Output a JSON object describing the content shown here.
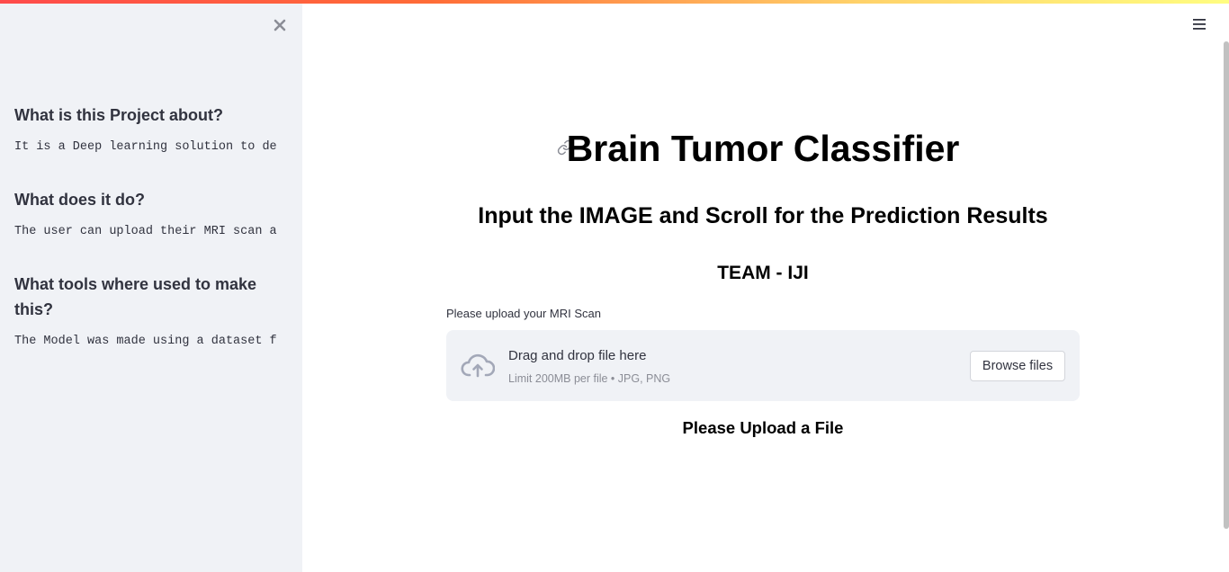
{
  "app": {
    "accent_gradient": [
      "#ff4b4b",
      "#ffd26a",
      "#fffd80"
    ],
    "sidebar_bg": "#f0f2f6"
  },
  "sidebar": {
    "close_icon": "close-icon",
    "sections": [
      {
        "heading": "What is this Project about?",
        "text": "It is a Deep learning solution to de"
      },
      {
        "heading": "What does it do?",
        "text": "The user can upload their MRI scan a"
      },
      {
        "heading": "What tools where used to make this?",
        "text": "The Model was made using a dataset f"
      }
    ]
  },
  "header": {
    "menu_icon": "hamburger-menu-icon"
  },
  "main": {
    "anchor_icon": "link-icon",
    "title": "Brain Tumor Classifier",
    "subtitle": "Input the IMAGE and Scroll for the Prediction Results",
    "team": "TEAM - IJI",
    "uploader": {
      "label": "Please upload your MRI Scan",
      "icon": "cloud-upload-icon",
      "drop_text": "Drag and drop file here",
      "limit_text": "Limit 200MB per file • JPG, PNG",
      "browse_label": "Browse files"
    },
    "status_text": "Please Upload a File"
  }
}
